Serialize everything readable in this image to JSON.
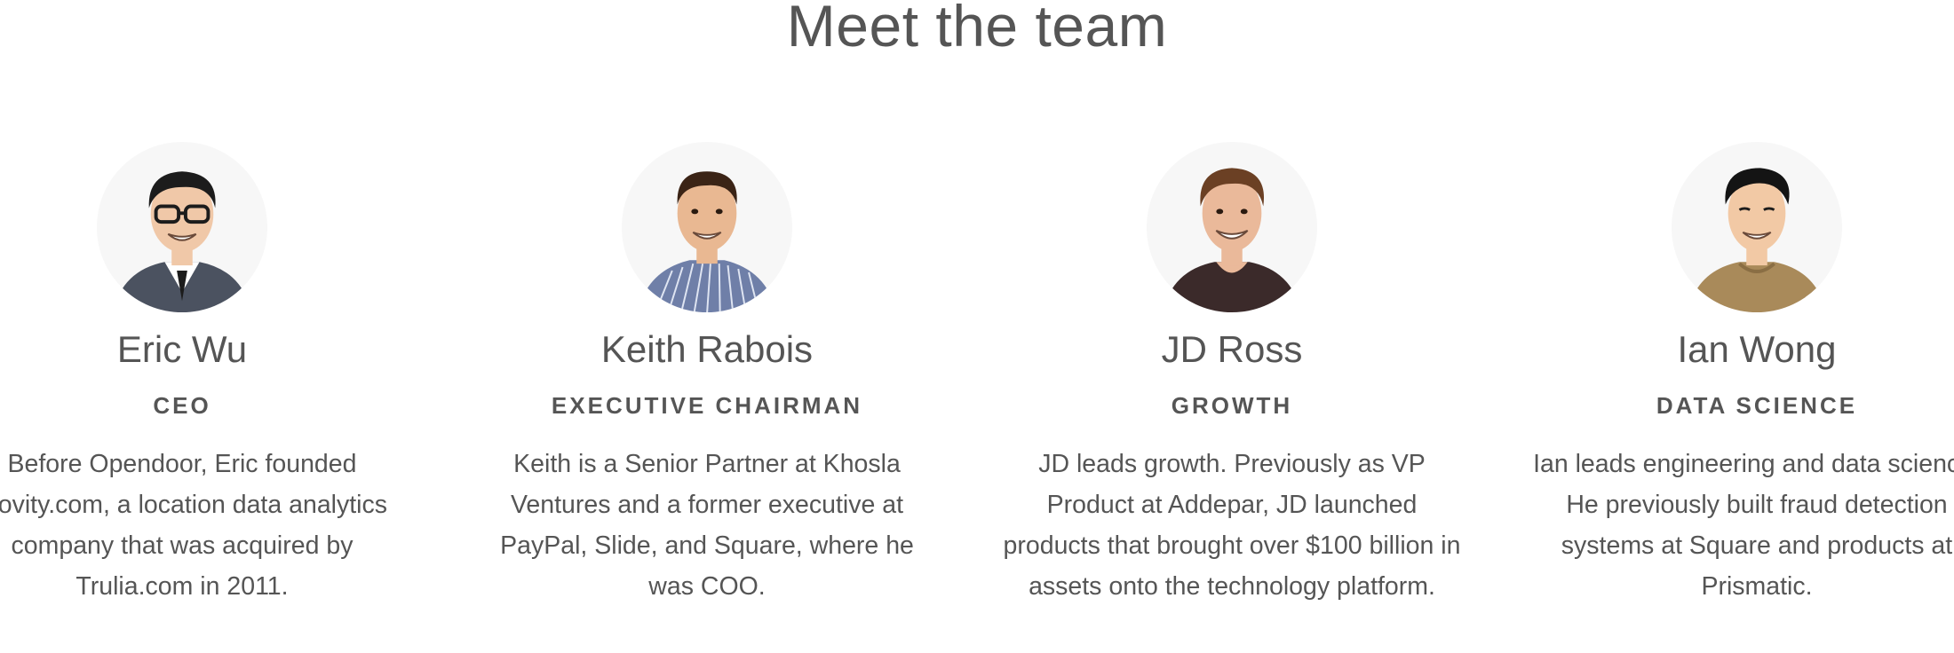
{
  "page": {
    "title": "Meet the team"
  },
  "team": [
    {
      "name": "Eric Wu",
      "role": "CEO",
      "bio": "Before Opendoor, Eric founded Movity.com, a location data analytics company that was acquired by Trulia.com in 2011.",
      "avatar_icon": "portrait-eric-wu",
      "colors": {
        "hair": "#1c1c1c",
        "skin": "#f0c8a8",
        "shirt": "#4b5260"
      }
    },
    {
      "name": "Keith Rabois",
      "role": "EXECUTIVE CHAIRMAN",
      "bio": "Keith is a Senior Partner at Khosla Ventures and a former executive at PayPal, Slide, and Square, where he was COO.",
      "avatar_icon": "portrait-keith-rabois",
      "colors": {
        "hair": "#3b2416",
        "skin": "#e9b892",
        "shirt": "#6f7fa8"
      }
    },
    {
      "name": "JD Ross",
      "role": "GROWTH",
      "bio": "JD leads growth. Previously as VP Product at Addepar, JD launched products that brought over $100 billion in assets onto the technology platform.",
      "avatar_icon": "portrait-jd-ross",
      "colors": {
        "hair": "#6b4024",
        "skin": "#eab99a",
        "shirt": "#3b2a2a"
      }
    },
    {
      "name": "Ian Wong",
      "role": "DATA SCIENCE",
      "bio": "Ian leads engineering and data science. He previously built fraud detection systems at Square and products at Prismatic.",
      "avatar_icon": "portrait-ian-wong",
      "colors": {
        "hair": "#141414",
        "skin": "#f2c9a5",
        "shirt": "#a98a5a"
      }
    }
  ]
}
